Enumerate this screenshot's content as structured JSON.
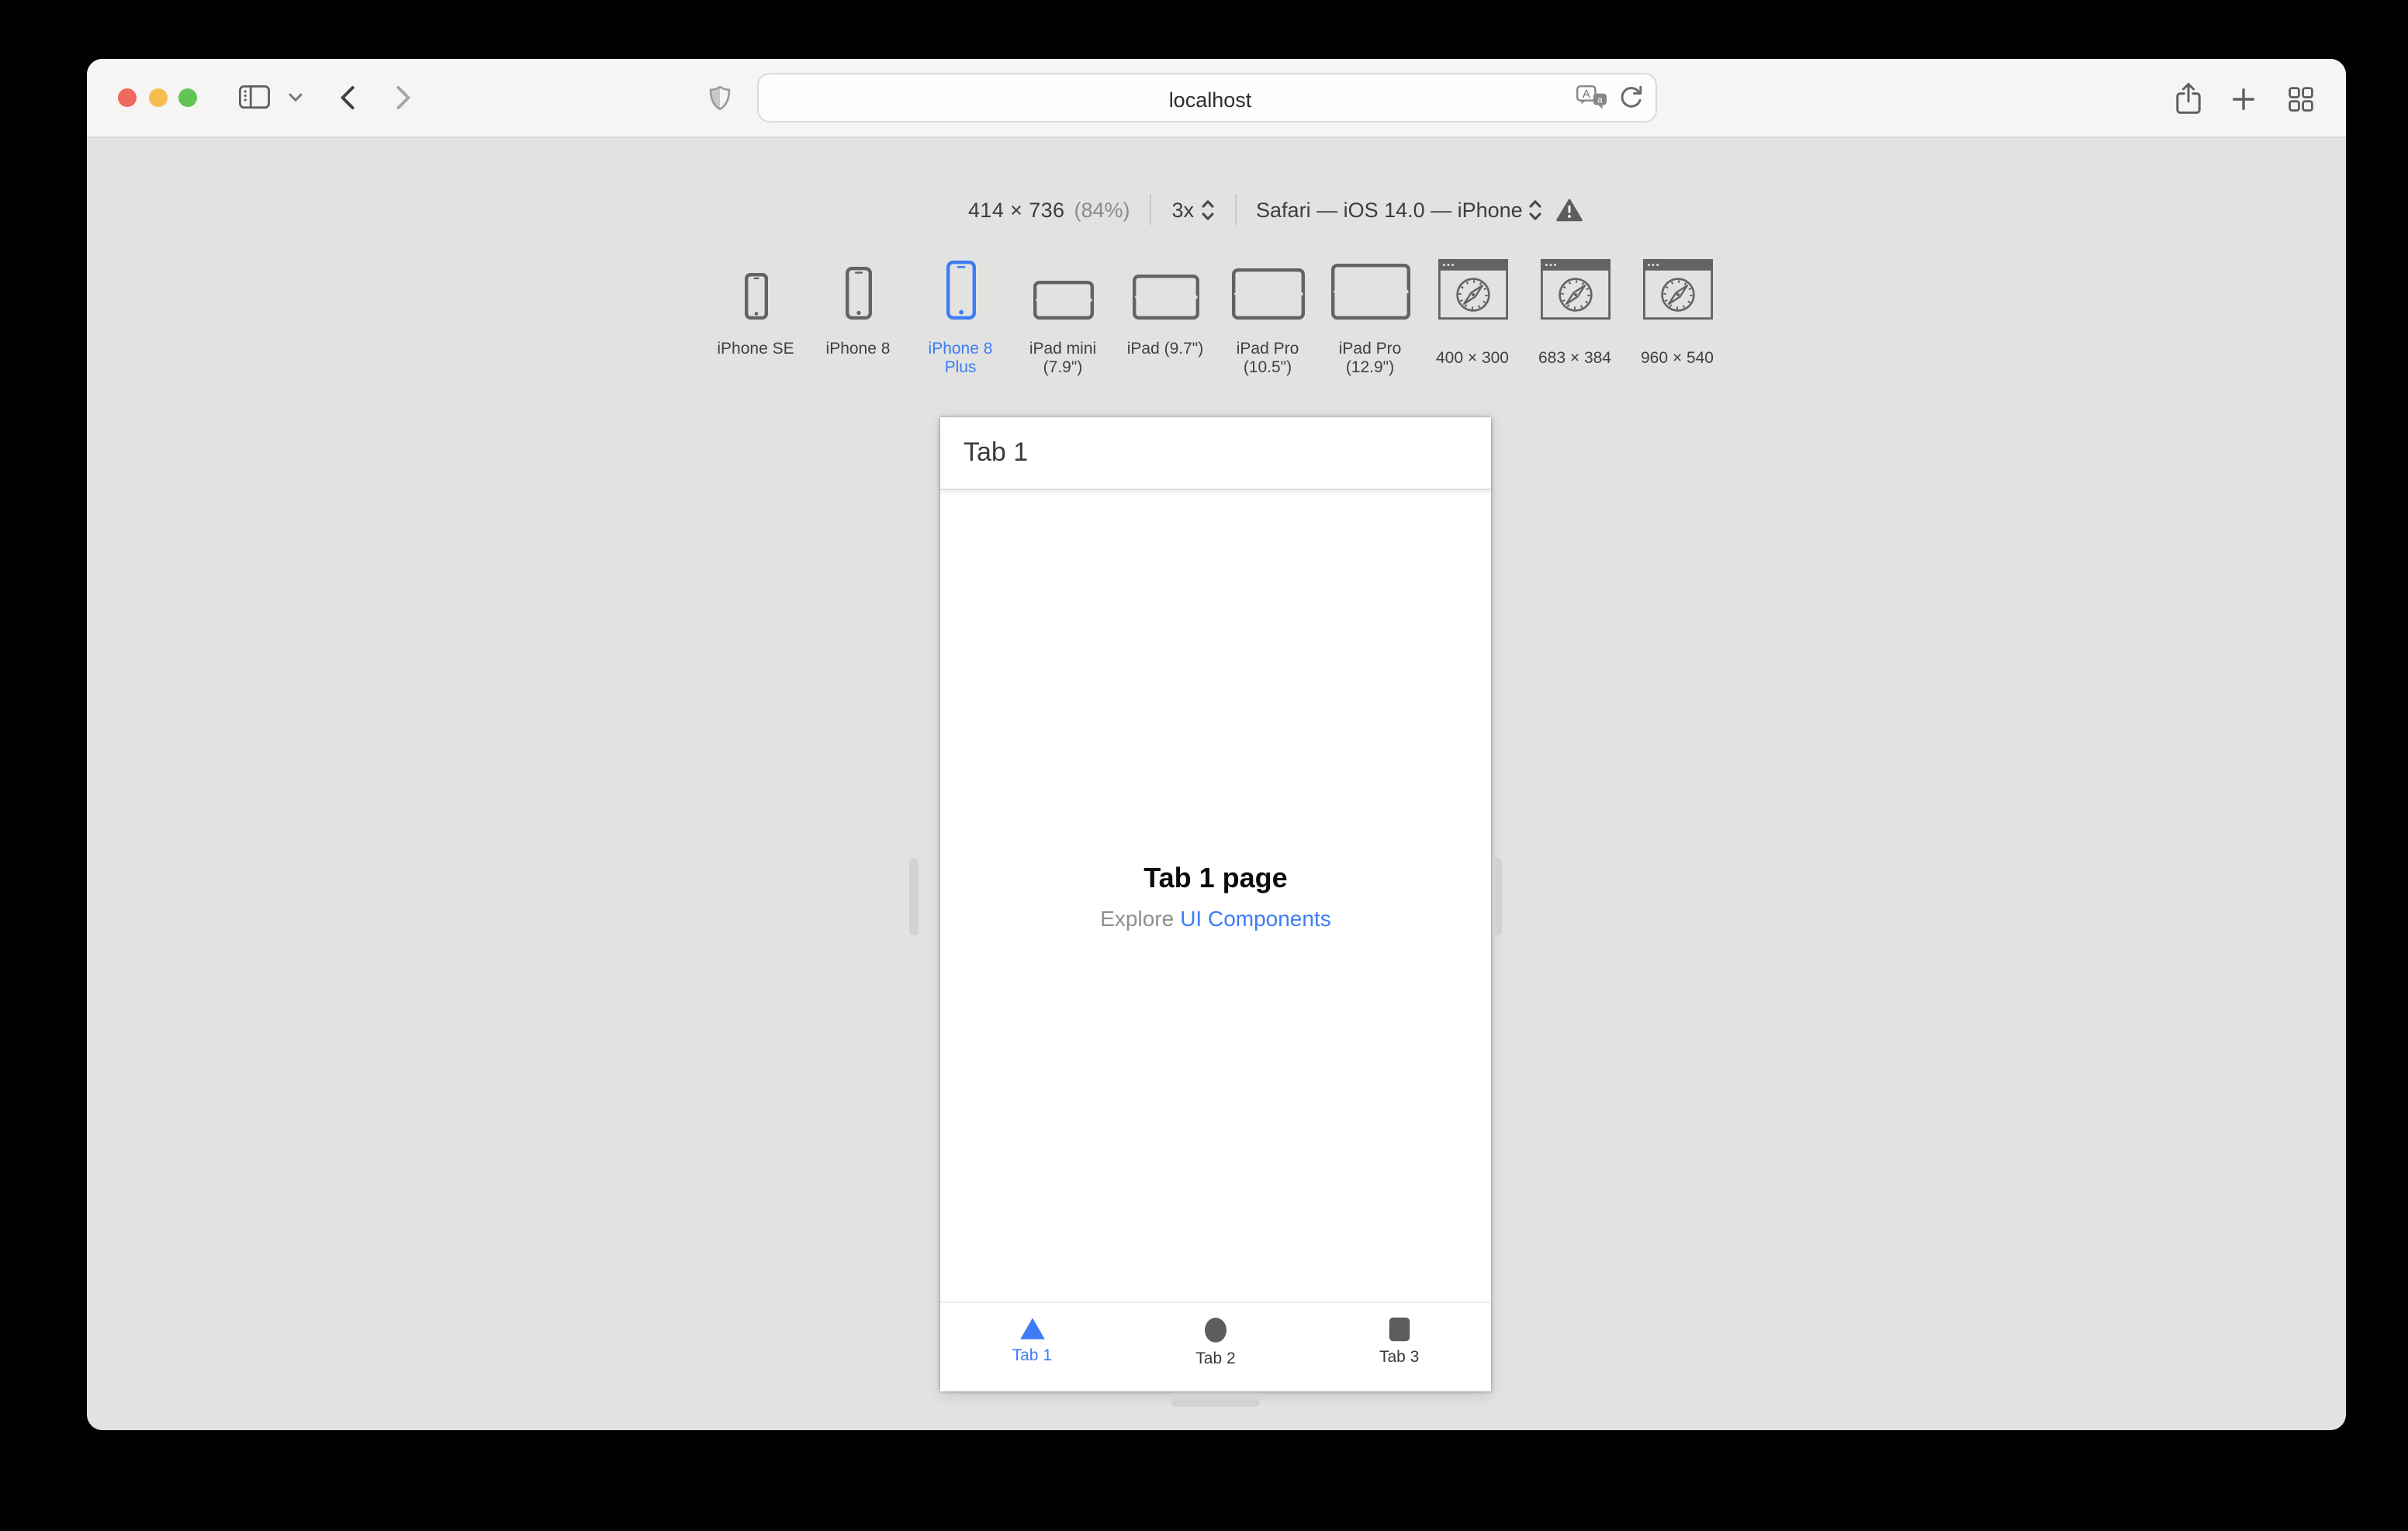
{
  "browser": {
    "url": "localhost",
    "icons": {
      "traffic_lights": [
        "close",
        "minimize",
        "zoom"
      ],
      "sidebar": "sidebar-panel-icon",
      "sidebar_menu": "chevron-down-icon",
      "back": "chevron-left-icon",
      "forward": "chevron-right-icon",
      "privacy": "shield-icon",
      "translate": "translate-icon",
      "reload": "reload-icon",
      "share": "share-icon",
      "new_tab": "plus-icon",
      "tab_overview": "grid-icon"
    }
  },
  "rdm": {
    "dimensions": "414 × 736",
    "zoom_percent": "(84%)",
    "pixel_ratio": "3x",
    "user_agent": "Safari — iOS 14.0 — iPhone",
    "warning_icon": "exclamation-triangle-icon",
    "devices": [
      {
        "label": "iPhone SE",
        "selected": false
      },
      {
        "label": "iPhone 8",
        "selected": false
      },
      {
        "label": "iPhone 8 Plus",
        "selected": true
      },
      {
        "label": "iPad mini (7.9\")",
        "selected": false
      },
      {
        "label": "iPad (9.7\")",
        "selected": false
      },
      {
        "label": "iPad Pro (10.5\")",
        "selected": false
      },
      {
        "label": "iPad Pro (12.9\")",
        "selected": false
      },
      {
        "label": "400 × 300",
        "selected": false
      },
      {
        "label": "683 × 384",
        "selected": false
      },
      {
        "label": "960 × 540",
        "selected": false
      }
    ]
  },
  "preview": {
    "nav_title": "Tab 1",
    "heading": "Tab 1 page",
    "subtext_prefix": "Explore",
    "link_label": "UI Components",
    "tab_bar": [
      {
        "label": "Tab 1",
        "icon": "triangle",
        "active": true
      },
      {
        "label": "Tab 2",
        "icon": "circle",
        "active": false
      },
      {
        "label": "Tab 3",
        "icon": "rounded-square",
        "active": false
      }
    ]
  },
  "colors": {
    "accent_blue": "#3D7CF6",
    "traffic_red": "#EE6A5F",
    "traffic_yellow": "#F5BD4F",
    "traffic_green": "#61C455",
    "icon_gray": "#636365",
    "canvas_gray": "#E2E2E1",
    "toolbar_gray": "#F6F5F4"
  }
}
